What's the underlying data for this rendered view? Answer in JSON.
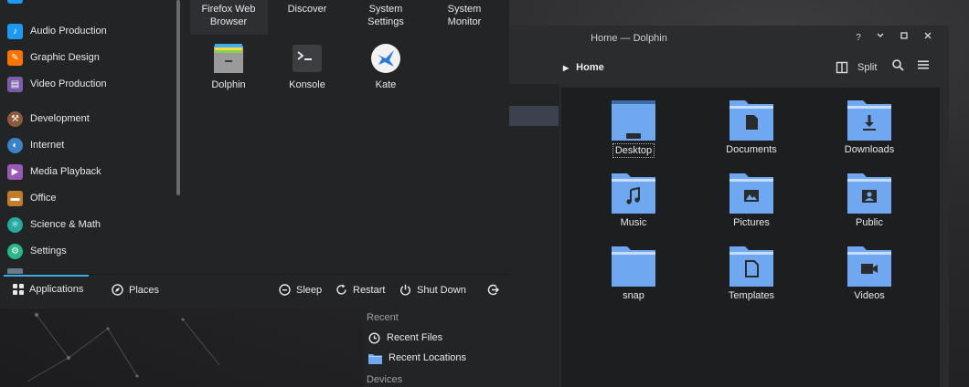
{
  "dolphin": {
    "window_title": "Home — Dolphin",
    "title_buttons": {
      "help": "?",
      "minimize": "⌄",
      "maximize": "□",
      "close": "✕"
    },
    "breadcrumb": "Home",
    "split_label": "Split",
    "places": {
      "recent_header": "Recent",
      "recent_files": "Recent Files",
      "recent_locations": "Recent Locations",
      "devices_header": "Devices"
    },
    "files": [
      {
        "name": "Desktop",
        "icon": "desktop-folder-icon"
      },
      {
        "name": "Documents",
        "icon": "documents-folder-icon"
      },
      {
        "name": "Downloads",
        "icon": "downloads-folder-icon"
      },
      {
        "name": "Music",
        "icon": "music-folder-icon"
      },
      {
        "name": "Pictures",
        "icon": "pictures-folder-icon"
      },
      {
        "name": "Public",
        "icon": "public-folder-icon"
      },
      {
        "name": "snap",
        "icon": "folder-icon"
      },
      {
        "name": "Templates",
        "icon": "templates-folder-icon"
      },
      {
        "name": "Videos",
        "icon": "videos-folder-icon"
      }
    ]
  },
  "launcher": {
    "categories": [
      {
        "label": "Audio Production",
        "color": "#1d99f3"
      },
      {
        "label": "Graphic Design",
        "color": "#f67400"
      },
      {
        "label": "Video Production",
        "color": "#7b5ea8"
      },
      {
        "label": "Development",
        "color": "#8c5a3c"
      },
      {
        "label": "Internet",
        "color": "#3b82c6"
      },
      {
        "label": "Media Playback",
        "color": "#9b59b6"
      },
      {
        "label": "Office",
        "color": "#c27c2c"
      },
      {
        "label": "Science & Math",
        "color": "#27a8a0"
      },
      {
        "label": "Settings",
        "color": "#2bb58a"
      }
    ],
    "apps_top": [
      {
        "label_line1": "Firefox Web",
        "label_line2": "Browser"
      },
      {
        "label_line1": "Discover",
        "label_line2": ""
      },
      {
        "label_line1": "System",
        "label_line2": "Settings"
      },
      {
        "label_line1": "System",
        "label_line2": "Monitor"
      }
    ],
    "apps": [
      {
        "label": "Dolphin",
        "icon": "dolphin-icon"
      },
      {
        "label": "Konsole",
        "icon": "konsole-icon"
      },
      {
        "label": "Kate",
        "icon": "kate-icon"
      }
    ],
    "bottom": {
      "applications": "Applications",
      "places": "Places",
      "sleep": "Sleep",
      "restart": "Restart",
      "shutdown": "Shut Down"
    }
  },
  "colors": {
    "accent": "#3daee9",
    "folder": "#6fa8f0",
    "folder_dark": "#4a7fc9"
  }
}
